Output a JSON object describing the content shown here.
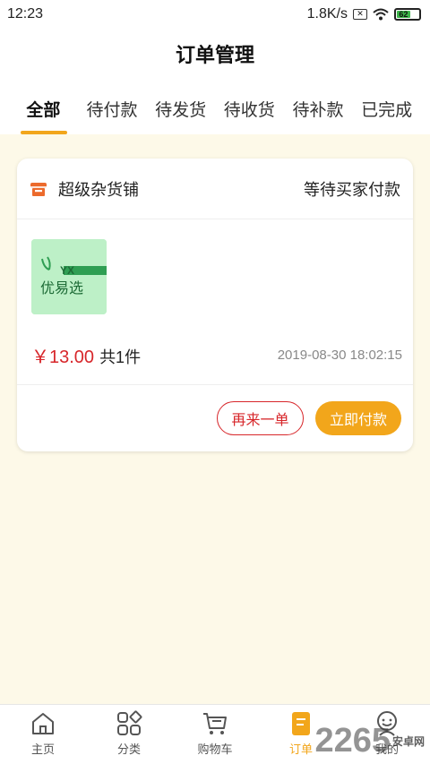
{
  "status_bar": {
    "time": "12:23",
    "network_speed": "1.8K/s",
    "battery_level": "62",
    "battery_fraction": 0.62
  },
  "page_title": "订单管理",
  "tabs": [
    {
      "label": "全部",
      "active": true
    },
    {
      "label": "待付款",
      "active": false
    },
    {
      "label": "待发货",
      "active": false
    },
    {
      "label": "待收货",
      "active": false
    },
    {
      "label": "待补款",
      "active": false
    },
    {
      "label": "已完成",
      "active": false
    }
  ],
  "order": {
    "shop_name": "超级杂货铺",
    "shop_icon": "store-icon",
    "status": "等待买家付款",
    "product_logo_text": "YX",
    "product_logo_caption": "优易选",
    "price": "￥13.00",
    "item_count": "共1件",
    "timestamp": "2019-08-30 18:02:15",
    "reorder_label": "再来一单",
    "pay_label": "立即付款"
  },
  "bottom_nav": [
    {
      "label": "主页",
      "icon": "home-icon"
    },
    {
      "label": "分类",
      "icon": "category-icon"
    },
    {
      "label": "购物车",
      "icon": "cart-icon"
    },
    {
      "label": "订单",
      "icon": "order-icon",
      "active": true
    },
    {
      "label": "我的",
      "icon": "profile-icon"
    }
  ],
  "watermark": {
    "text": "2265",
    "sub": "安卓网"
  },
  "colors": {
    "accent": "#f2a61b",
    "price_red": "#d7262a",
    "page_bg": "#fdf9e8"
  }
}
